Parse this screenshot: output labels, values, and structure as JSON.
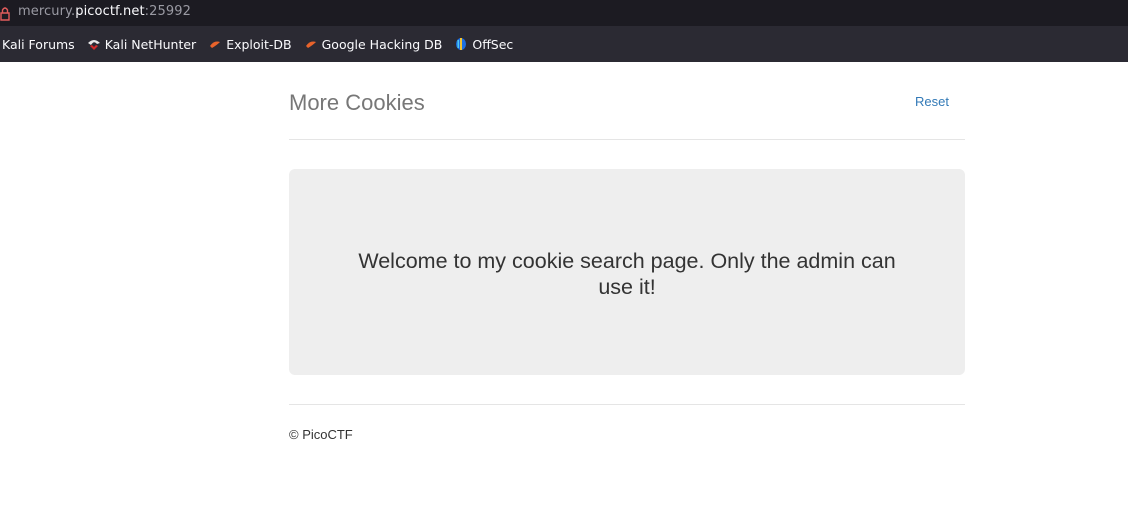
{
  "browser": {
    "url_prefix": "mercury.",
    "url_host": "picoctf.net",
    "url_suffix": ":25992",
    "bookmarks": [
      {
        "label": "Kali Forums",
        "icon": "kali-forums-icon"
      },
      {
        "label": "Kali NetHunter",
        "icon": "nethunter-icon"
      },
      {
        "label": "Exploit-DB",
        "icon": "exploit-db-icon"
      },
      {
        "label": "Google Hacking DB",
        "icon": "ghdb-icon"
      },
      {
        "label": "OffSec",
        "icon": "offsec-icon"
      }
    ]
  },
  "header": {
    "title": "More Cookies",
    "reset_label": "Reset"
  },
  "jumbotron": {
    "message": "Welcome to my cookie search page. Only the admin can use it!"
  },
  "footer": {
    "text": "© PicoCTF"
  },
  "colors": {
    "link": "#337ab7",
    "jumbotron_bg": "#eeeeee",
    "title": "#777777",
    "chrome_dark": "#1c1b22",
    "bookmarks_bar": "#2b2a33"
  }
}
